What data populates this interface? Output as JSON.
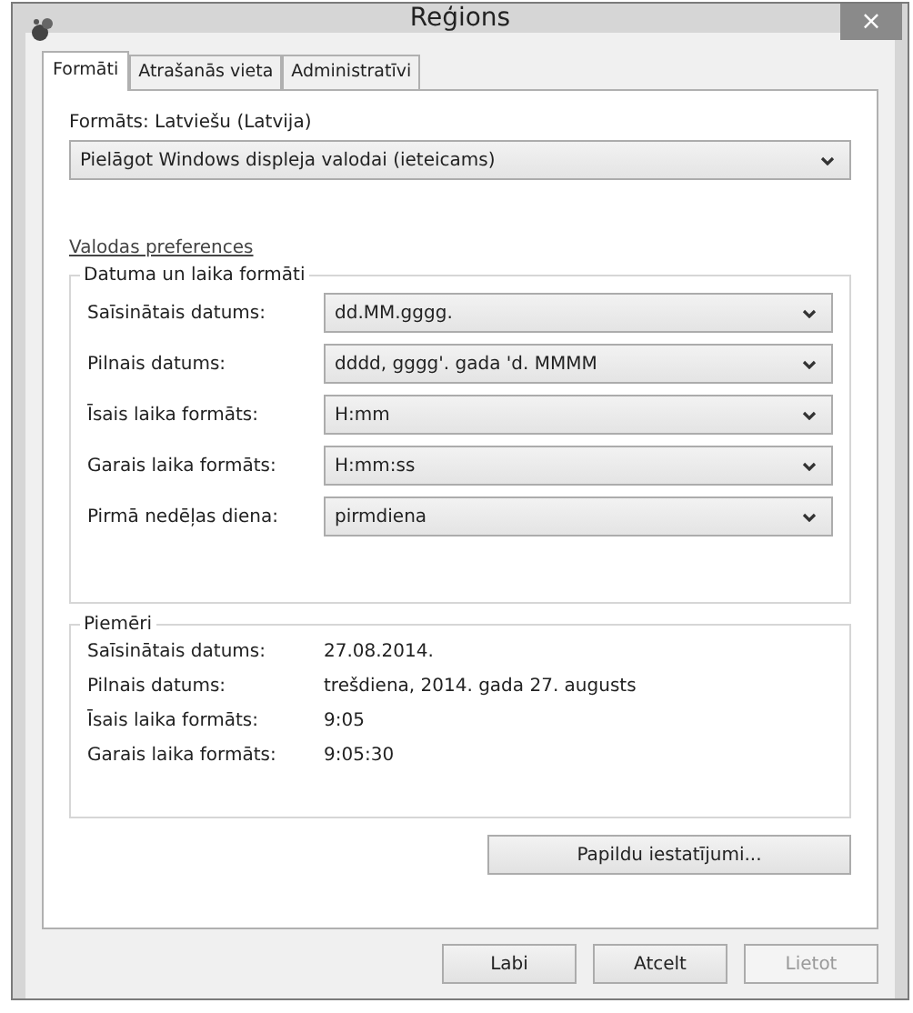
{
  "window": {
    "title": "Reģions",
    "close": "×"
  },
  "tabs": [
    {
      "label": "Formāti",
      "selected": true
    },
    {
      "label": "Atrašanās vieta",
      "selected": false
    },
    {
      "label": "Administratīvi",
      "selected": false
    }
  ],
  "format_label": "Formāts: Latviešu (Latvija)",
  "format_select": "Pielāgot Windows displeja valodai (ieteicams)",
  "language_link": "Valodas preferences",
  "formats_group": {
    "title": "Datuma un laika formāti",
    "rows": [
      {
        "label": "Saīsinātais datums:",
        "value": "dd.MM.gggg."
      },
      {
        "label": "Pilnais datums:",
        "value": "dddd, gggg'. gada 'd. MMMM"
      },
      {
        "label": "Īsais laika formāts:",
        "value": "H:mm"
      },
      {
        "label": "Garais laika formāts:",
        "value": "H:mm:ss"
      },
      {
        "label": "Pirmā nedēļas diena:",
        "value": "pirmdiena"
      }
    ]
  },
  "examples_group": {
    "title": "Piemēri",
    "rows": [
      {
        "label": "Saīsinātais datums:",
        "value": "27.08.2014."
      },
      {
        "label": "Pilnais datums:",
        "value": "trešdiena, 2014. gada 27. augusts"
      },
      {
        "label": "Īsais laika formāts:",
        "value": "9:05"
      },
      {
        "label": "Garais laika formāts:",
        "value": "9:05:30"
      }
    ]
  },
  "additional_button": "Papildu iestatījumi...",
  "buttons": [
    {
      "label": "Labi",
      "disabled": false
    },
    {
      "label": "Atcelt",
      "disabled": false
    },
    {
      "label": "Lietot",
      "disabled": true
    }
  ]
}
